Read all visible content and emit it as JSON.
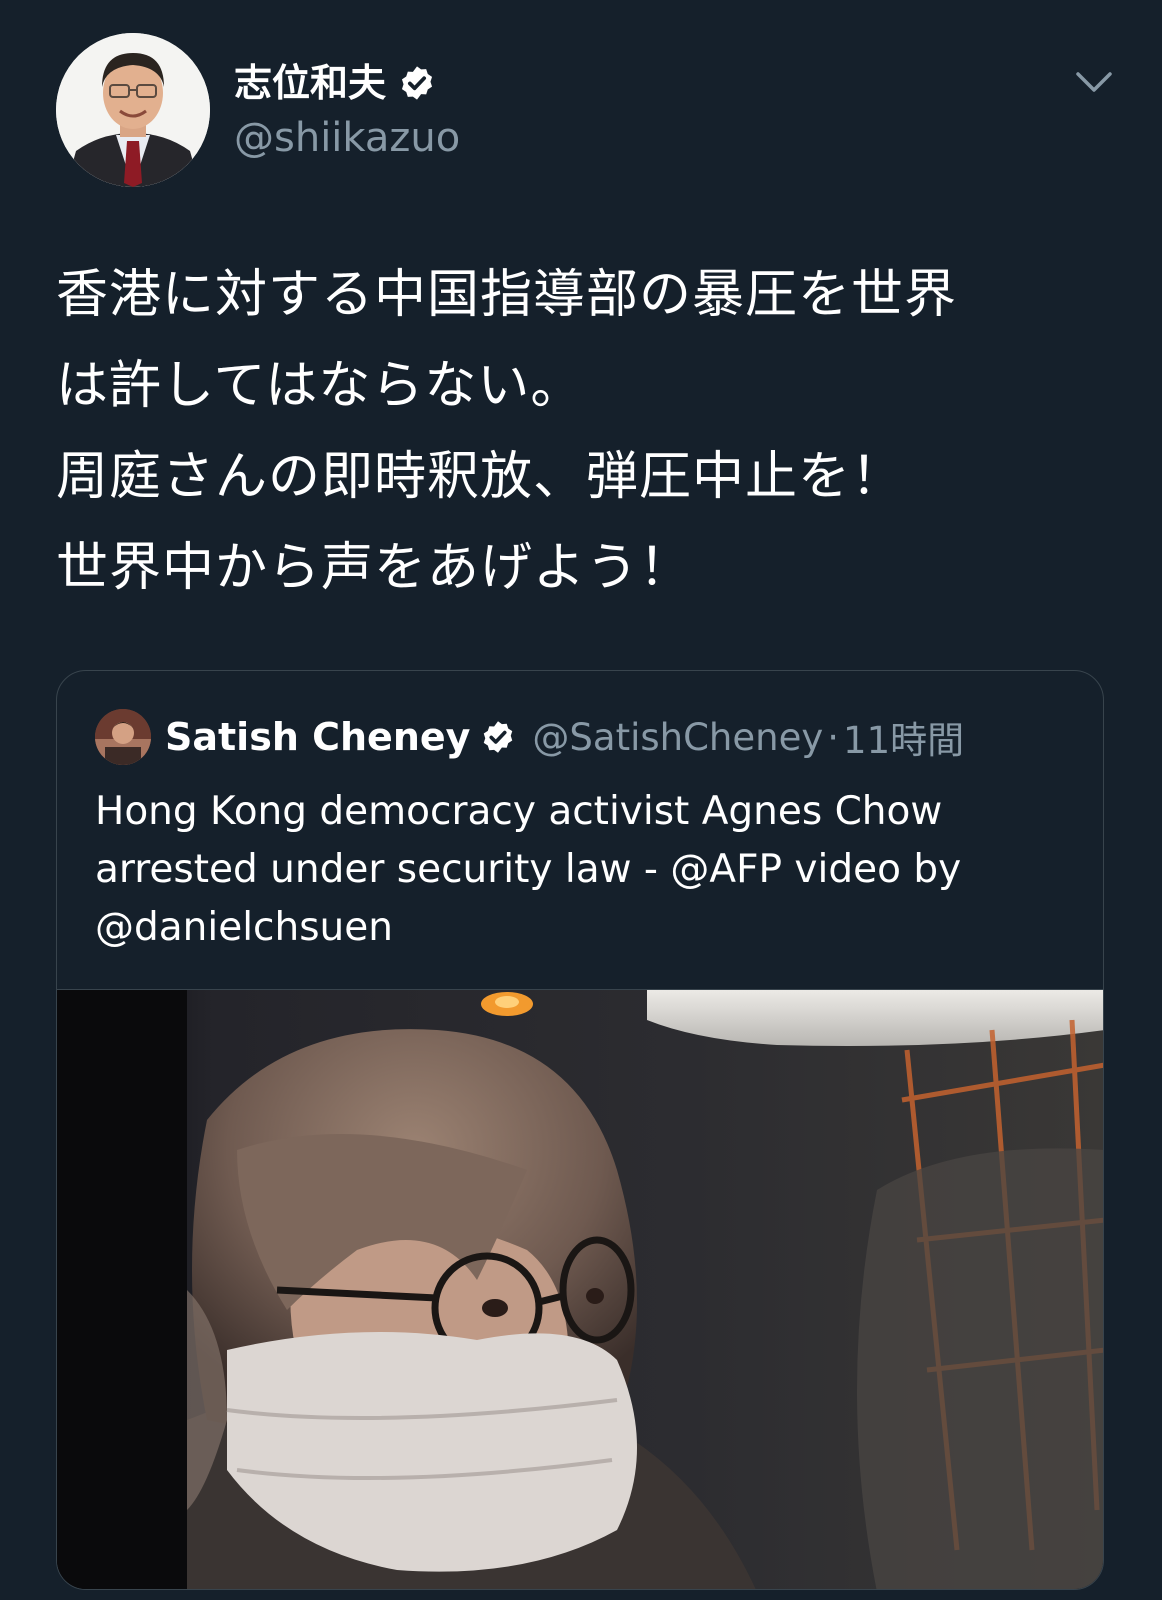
{
  "tweet": {
    "author": {
      "display_name": "志位和夫",
      "handle": "@shiikazuo",
      "verified": true
    },
    "text_lines": [
      "香港に対する中国指導部の暴圧を世界",
      "は許してはならない。",
      "周庭さんの即時釈放、弾圧中止を！",
      "世界中から声をあげよう！"
    ],
    "menu_icon": "chevron-down-icon"
  },
  "quote": {
    "author": {
      "display_name": "Satish Cheney",
      "handle": "@SatishCheney",
      "verified": true
    },
    "separator": "·",
    "time": "11時間",
    "text_lines": [
      "Hong Kong democracy activist Agnes Chow",
      "arrested under security law - @AFP  video by",
      "@danielchsuen"
    ],
    "media_type": "video-thumbnail"
  },
  "colors": {
    "background": "#15202b",
    "text_primary": "#ffffff",
    "text_secondary": "#8899a6",
    "border": "#38444d"
  }
}
